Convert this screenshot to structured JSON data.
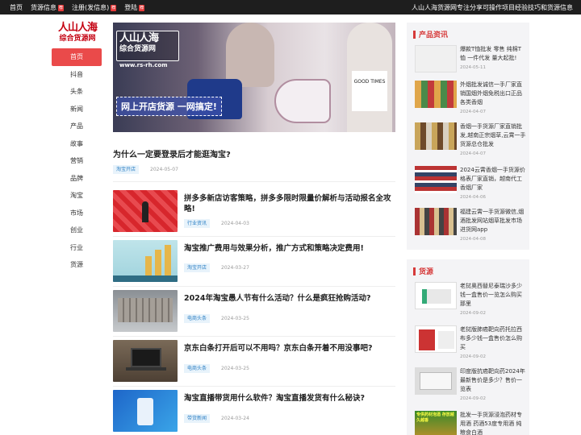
{
  "topbar": {
    "nav": [
      {
        "label": "首页",
        "badge": ""
      },
      {
        "label": "货源信息",
        "badge": "荐"
      },
      {
        "label": "注册(发信息)",
        "badge": "荐"
      },
      {
        "label": "登陆",
        "badge": "荐"
      }
    ],
    "slogan": "人山人海货源网专注分享可操作项目经验技巧和货源信息"
  },
  "logo": {
    "line1": "人山人海",
    "line2": "综合货源网"
  },
  "leftnav": [
    "首页",
    "抖音",
    "头条",
    "新闻",
    "产品",
    "故事",
    "营销",
    "品牌",
    "淘宝",
    "市场",
    "创业",
    "行业",
    "货源"
  ],
  "banner": {
    "title": "人山人海",
    "subtitle": "综合货源网",
    "url": "www.rs-rh.com",
    "slogan": "网上开店货源 一网搞定!",
    "shirt_text": "GOOD TIMES"
  },
  "featured": {
    "title": "为什么一定要登录后才能逛淘宝?",
    "tag": "淘宝开店",
    "date": "2024-05-07"
  },
  "articles": [
    {
      "title": "拼多多新店访客策略，拼多多限时限量价解析与活动报名全攻略!",
      "tag": "行业资讯",
      "date": "2024-04-03"
    },
    {
      "title": "淘宝推广费用与效果分析，推广方式和策略决定费用!",
      "tag": "淘宝开店",
      "date": "2024-03-27"
    },
    {
      "title": "2024年淘宝愚人节有什么活动？什么是疯狂抢购活动?",
      "tag": "电商头条",
      "date": "2024-03-25"
    },
    {
      "title": "京东白条打开后可以不用吗？京东白条开着不用没事吧?",
      "tag": "电商头条",
      "date": "2024-03-25"
    },
    {
      "title": "淘宝直播带货用什么软件？淘宝直播发货有什么秘诀?",
      "tag": "带货新闻",
      "date": "2024-03-24"
    }
  ],
  "sidebar_products": {
    "heading": "产品资讯",
    "items": [
      {
        "title": "爆款T恤批发 零售 纯棉T恤 一件代发 量大起批!",
        "date": "2024-05-11"
      },
      {
        "title": "外烟批发诚信一手厂家直销国烟外烟免税出口正品各类香烟",
        "date": "2024-04-07"
      },
      {
        "title": "香烟一手货源厂家直销批发,越南正宗烟草,云霄一手货源总仓批发",
        "date": "2024-04-07"
      },
      {
        "title": "2024云霄香烟一手货源价格表厂家直销，越南代工香烟厂家",
        "date": "2024-04-06"
      },
      {
        "title": "福建云霄一手货源微信,烟酒批发网站烟草批发市场进货网app",
        "date": "2024-04-08"
      }
    ]
  },
  "sidebar_sources": {
    "heading": "货源",
    "items": [
      {
        "title": "老挝奥西替尼泰瑞沙多少钱一盒售价一览怎么购买那里",
        "date": "2024-09-02"
      },
      {
        "title": "老挝版肺癌靶向药托拉西布多少钱一盒售价怎么购买",
        "date": "2024-09-02"
      },
      {
        "title": "印度版抗癌靶向药2024年最新售价是多少？售价一览表",
        "date": "2024-09-02"
      },
      {
        "title": "批发一手货源浸泡药材专用酒 药酒53度专用酒 纯粮食白酒",
        "date": "",
        "thumb_text": "专供药材泡酒 存放越久越香"
      }
    ]
  },
  "colors": {
    "accent": "#ea4a4a",
    "tag_bg": "#e8f3fb",
    "tag_text": "#2b7fc4",
    "topbar": "#1e1e1e"
  }
}
